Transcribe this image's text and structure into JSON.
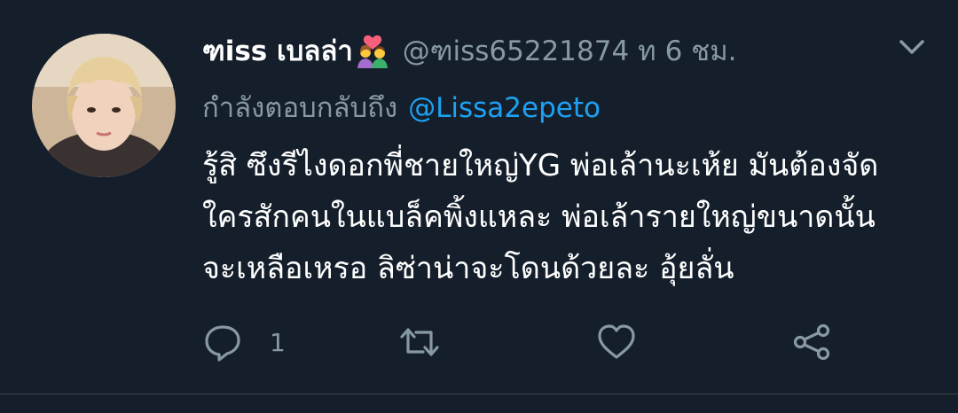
{
  "tweet": {
    "display_name": "ฑiss เบลล่า",
    "emoji": "couple-with-heart-emoji",
    "handle": "@ฑiss65221874",
    "separator": "ท",
    "time": "6 ชม.",
    "reply_prefix": "กำลังตอบกลับถึง",
    "reply_mention": "@Lissa2epeto",
    "body_lines": [
      "รู้สิ ซึงรีไงดอกพี่ชายใหญ่YG พ่อเล้านะเห้ย มันต้องจัด",
      "ใครสักคนในแบล็คพิ้งแหละ พ่อเล้ารายใหญ่ขนาดนั้น",
      "จะเหลือเหรอ ลิซ่าน่าจะโดนด้วยละ อุ้ยลั่น"
    ],
    "reply_count": "1"
  },
  "icons": {
    "avatar": "avatar",
    "menu": "chevron-down-icon",
    "reply": "reply-icon",
    "retweet": "retweet-icon",
    "like": "heart-icon",
    "share": "share-icon"
  },
  "colors": {
    "background": "#151f2b",
    "muted_text": "#8899a6",
    "link": "#1da1f2",
    "primary_text": "#ffffff",
    "divider": "#38444d"
  }
}
